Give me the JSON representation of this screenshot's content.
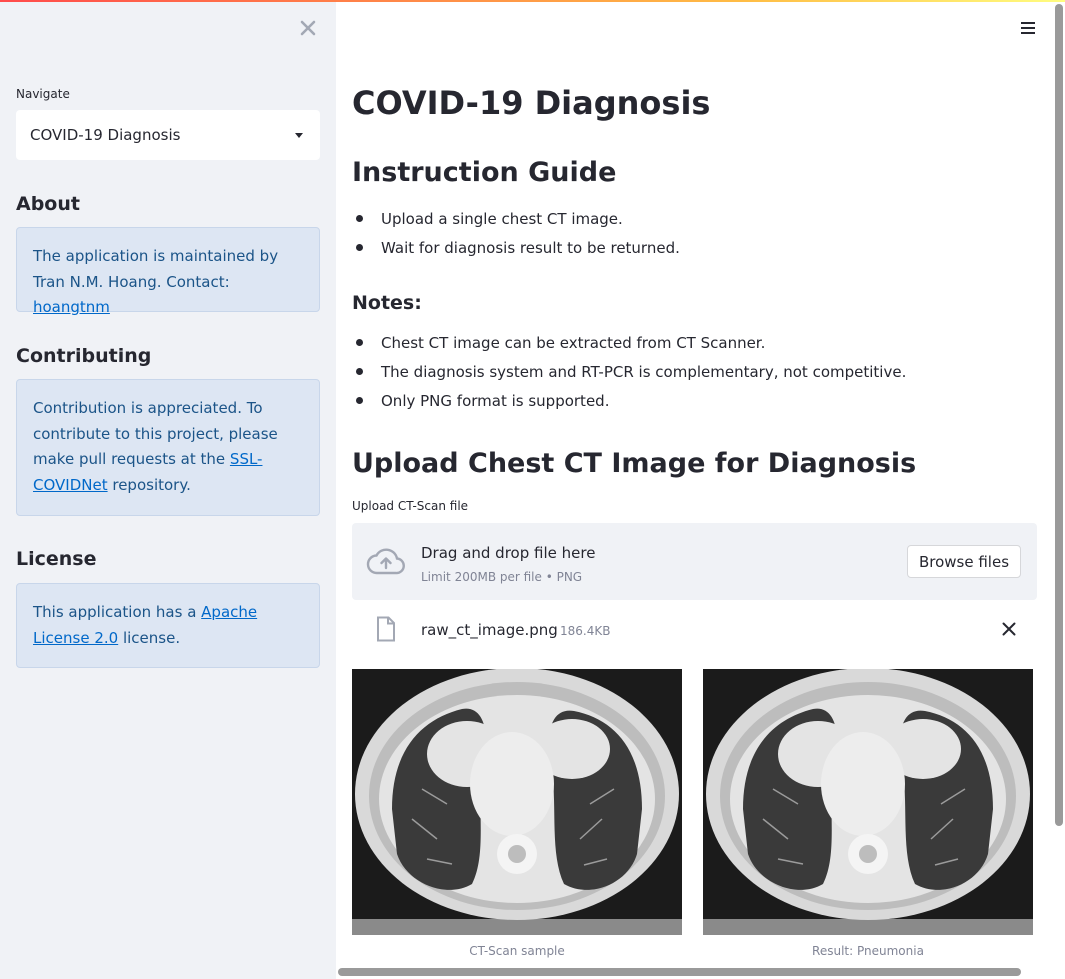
{
  "sidebar": {
    "close_icon": "close-icon",
    "nav_label": "Navigate",
    "nav_selected": "COVID-19 Diagnosis",
    "about": {
      "heading": "About",
      "text": "The application is maintained by Tran N.M. Hoang. Contact: ",
      "link": "hoangtnm"
    },
    "contributing": {
      "heading": "Contributing",
      "text": "Contribution is appreciated. To contribute to this project, please make pull requests at the ",
      "link": "SSL-COVIDNet",
      "text_after": " repository."
    },
    "license": {
      "heading": "License",
      "text": "This application has a ",
      "link": "Apache License 2.0",
      "text_after": " license."
    }
  },
  "main": {
    "menu_icon": "hamburger-menu-icon",
    "title": "COVID-19 Diagnosis",
    "guide_heading": "Instruction Guide",
    "guide_items": [
      "Upload a single chest CT image.",
      "Wait for diagnosis result to be returned."
    ],
    "notes_heading": "Notes:",
    "notes_items": [
      "Chest CT image can be extracted from CT Scanner.",
      "The diagnosis system and RT-PCR is complementary, not competitive.",
      "Only PNG format is supported."
    ],
    "upload_heading": "Upload Chest CT Image for Diagnosis",
    "uploader": {
      "label": "Upload CT-Scan file",
      "drag_text": "Drag and drop file here",
      "limit_text": "Limit 200MB per file • PNG",
      "browse_label": "Browse files",
      "file_name": "raw_ct_image.png",
      "file_size": "186.4KB"
    },
    "images": [
      {
        "caption": "CT-Scan sample"
      },
      {
        "caption": "Result: Pneumonia"
      }
    ]
  },
  "colors": {
    "sidebar_bg": "#f0f2f6",
    "info_bg": "#dde6f3",
    "info_text": "#1b5488",
    "link": "#0068c9",
    "text": "#262730",
    "muted": "#808495"
  }
}
